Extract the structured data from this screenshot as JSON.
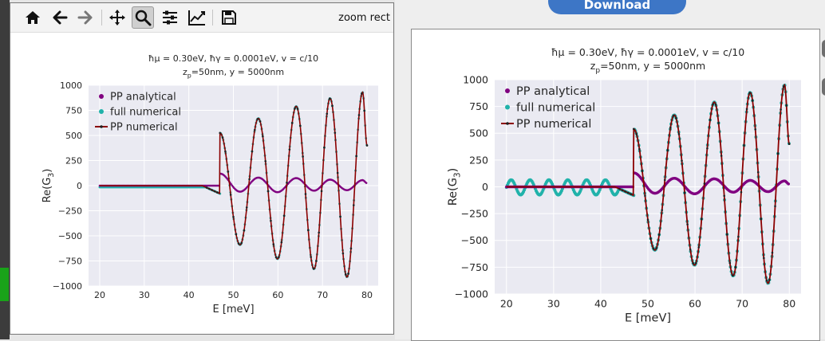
{
  "toolbar": {
    "icons": [
      "home-icon",
      "back-arrow-icon",
      "forward-arrow-icon",
      "pan-icon",
      "zoom-icon",
      "subplots-config-icon",
      "axes-edit-icon",
      "save-icon"
    ],
    "mode_text": "zoom rect"
  },
  "download_button": {
    "label": "Download"
  },
  "colors": {
    "analytical": "#800080",
    "full_numerical": "#20b2aa",
    "pp_numerical": "#8b0000",
    "axes_bg": "#eaeaf2",
    "button": "#3d76c6"
  },
  "chart_data": [
    {
      "type": "line",
      "panel": "left",
      "title_line1": "ħμ = 0.30eV, ħγ = 0.0001eV, v = c/10",
      "title_line2_prefix": "z",
      "title_line2_sub": "p",
      "title_line2_suffix": "=50nm, y = 5000nm",
      "xlabel": "E [meV]",
      "ylabel_prefix": "Re(G",
      "ylabel_sub": "3",
      "ylabel_suffix": ")",
      "xlim": [
        17.5,
        82.5
      ],
      "ylim": [
        -1000,
        1000
      ],
      "xticks": [
        20,
        30,
        40,
        50,
        60,
        70,
        80
      ],
      "yticks": [
        1000,
        750,
        500,
        250,
        0,
        -250,
        -500,
        -750,
        -1000
      ],
      "ytick_labels": [
        "1000",
        "750",
        "500",
        "250",
        "0",
        "−250",
        "−500",
        "−750",
        "−1000"
      ],
      "grid": true,
      "legend_position": "top-left",
      "series": [
        {
          "name": "PP analytical",
          "marker": "dot"
        },
        {
          "name": "full numerical",
          "marker": "dot"
        },
        {
          "name": "PP numerical",
          "marker": "line-dot"
        }
      ],
      "pp_numerical_extrema": [
        [
          47,
          525
        ],
        [
          51.5,
          -590
        ],
        [
          55.6,
          670
        ],
        [
          59.9,
          -730
        ],
        [
          64.1,
          790
        ],
        [
          68.1,
          -830
        ],
        [
          71.7,
          870
        ],
        [
          75.5,
          -910
        ],
        [
          79,
          930
        ],
        [
          80,
          400
        ]
      ],
      "pp_analytical_extrema": [
        [
          47,
          120
        ],
        [
          51.5,
          -60
        ],
        [
          55.6,
          80
        ],
        [
          59.9,
          -65
        ],
        [
          64.1,
          75
        ],
        [
          68.1,
          -50
        ],
        [
          71.7,
          60
        ],
        [
          75.5,
          -45
        ],
        [
          79,
          55
        ],
        [
          80,
          25
        ]
      ],
      "full_numerical_offset": -15
    },
    {
      "type": "line",
      "panel": "right",
      "title_line1": "ħμ = 0.30eV, ħγ = 0.0001eV, v = c/10",
      "title_line2_prefix": "z",
      "title_line2_sub": "p",
      "title_line2_suffix": "=50nm, y = 5000nm",
      "xlabel": "E [meV]",
      "ylabel_prefix": "Re(G",
      "ylabel_sub": "3",
      "ylabel_suffix": ")",
      "xlim": [
        17.5,
        82.5
      ],
      "ylim": [
        -1000,
        1000
      ],
      "xticks": [
        20,
        30,
        40,
        50,
        60,
        70,
        80
      ],
      "yticks": [
        1000,
        750,
        500,
        250,
        0,
        -250,
        -500,
        -750,
        -1000
      ],
      "ytick_labels": [
        "1000",
        "750",
        "500",
        "250",
        "0",
        "−250",
        "−500",
        "−750",
        "−1000"
      ],
      "grid": true,
      "legend_position": "top-left",
      "series": [
        {
          "name": "PP analytical",
          "marker": "dot"
        },
        {
          "name": "full numerical",
          "marker": "dot"
        },
        {
          "name": "PP numerical",
          "marker": "line-dot"
        }
      ],
      "pp_numerical_extrema": [
        [
          47,
          540
        ],
        [
          51.5,
          -590
        ],
        [
          55.6,
          670
        ],
        [
          59.9,
          -730
        ],
        [
          64.1,
          790
        ],
        [
          68.1,
          -830
        ],
        [
          71.7,
          880
        ],
        [
          75.5,
          -900
        ],
        [
          79,
          950
        ],
        [
          80,
          400
        ]
      ],
      "pp_analytical_extrema": [
        [
          47,
          130
        ],
        [
          51.5,
          -60
        ],
        [
          55.6,
          80
        ],
        [
          59.9,
          -65
        ],
        [
          64.1,
          75
        ],
        [
          68.1,
          -50
        ],
        [
          71.7,
          60
        ],
        [
          75.5,
          -45
        ],
        [
          79,
          55
        ],
        [
          80,
          25
        ]
      ],
      "full_numerical_oscillation": {
        "x_end": 44,
        "amplitude": 70,
        "period_meV": 4
      }
    }
  ]
}
